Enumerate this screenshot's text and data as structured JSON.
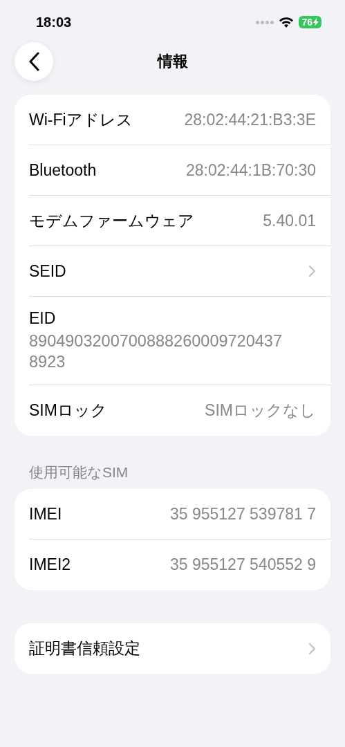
{
  "status_bar": {
    "time": "18:03",
    "battery": "76",
    "charging": true
  },
  "nav": {
    "title": "情報"
  },
  "groups": [
    {
      "rows": [
        {
          "kind": "value",
          "label": "Wi-Fiアドレス",
          "value": "28:02:44:21:B3:3E"
        },
        {
          "kind": "value",
          "label": "Bluetooth",
          "value": "28:02:44:1B:70:30"
        },
        {
          "kind": "value",
          "label": "モデムファームウェア",
          "value": "5.40.01"
        },
        {
          "kind": "link",
          "label": "SEID"
        },
        {
          "kind": "stacked",
          "label": "EID",
          "value": "89049032007008882600097204378923"
        },
        {
          "kind": "value",
          "label": "SIMロック",
          "value": "SIMロックなし"
        }
      ]
    },
    {
      "header": "使用可能なSIM",
      "rows": [
        {
          "kind": "value",
          "label": "IMEI",
          "value": "35 955127 539781 7"
        },
        {
          "kind": "value",
          "label": "IMEI2",
          "value": "35 955127 540552 9"
        }
      ]
    },
    {
      "rows": [
        {
          "kind": "link",
          "label": "証明書信頼設定"
        }
      ]
    }
  ]
}
